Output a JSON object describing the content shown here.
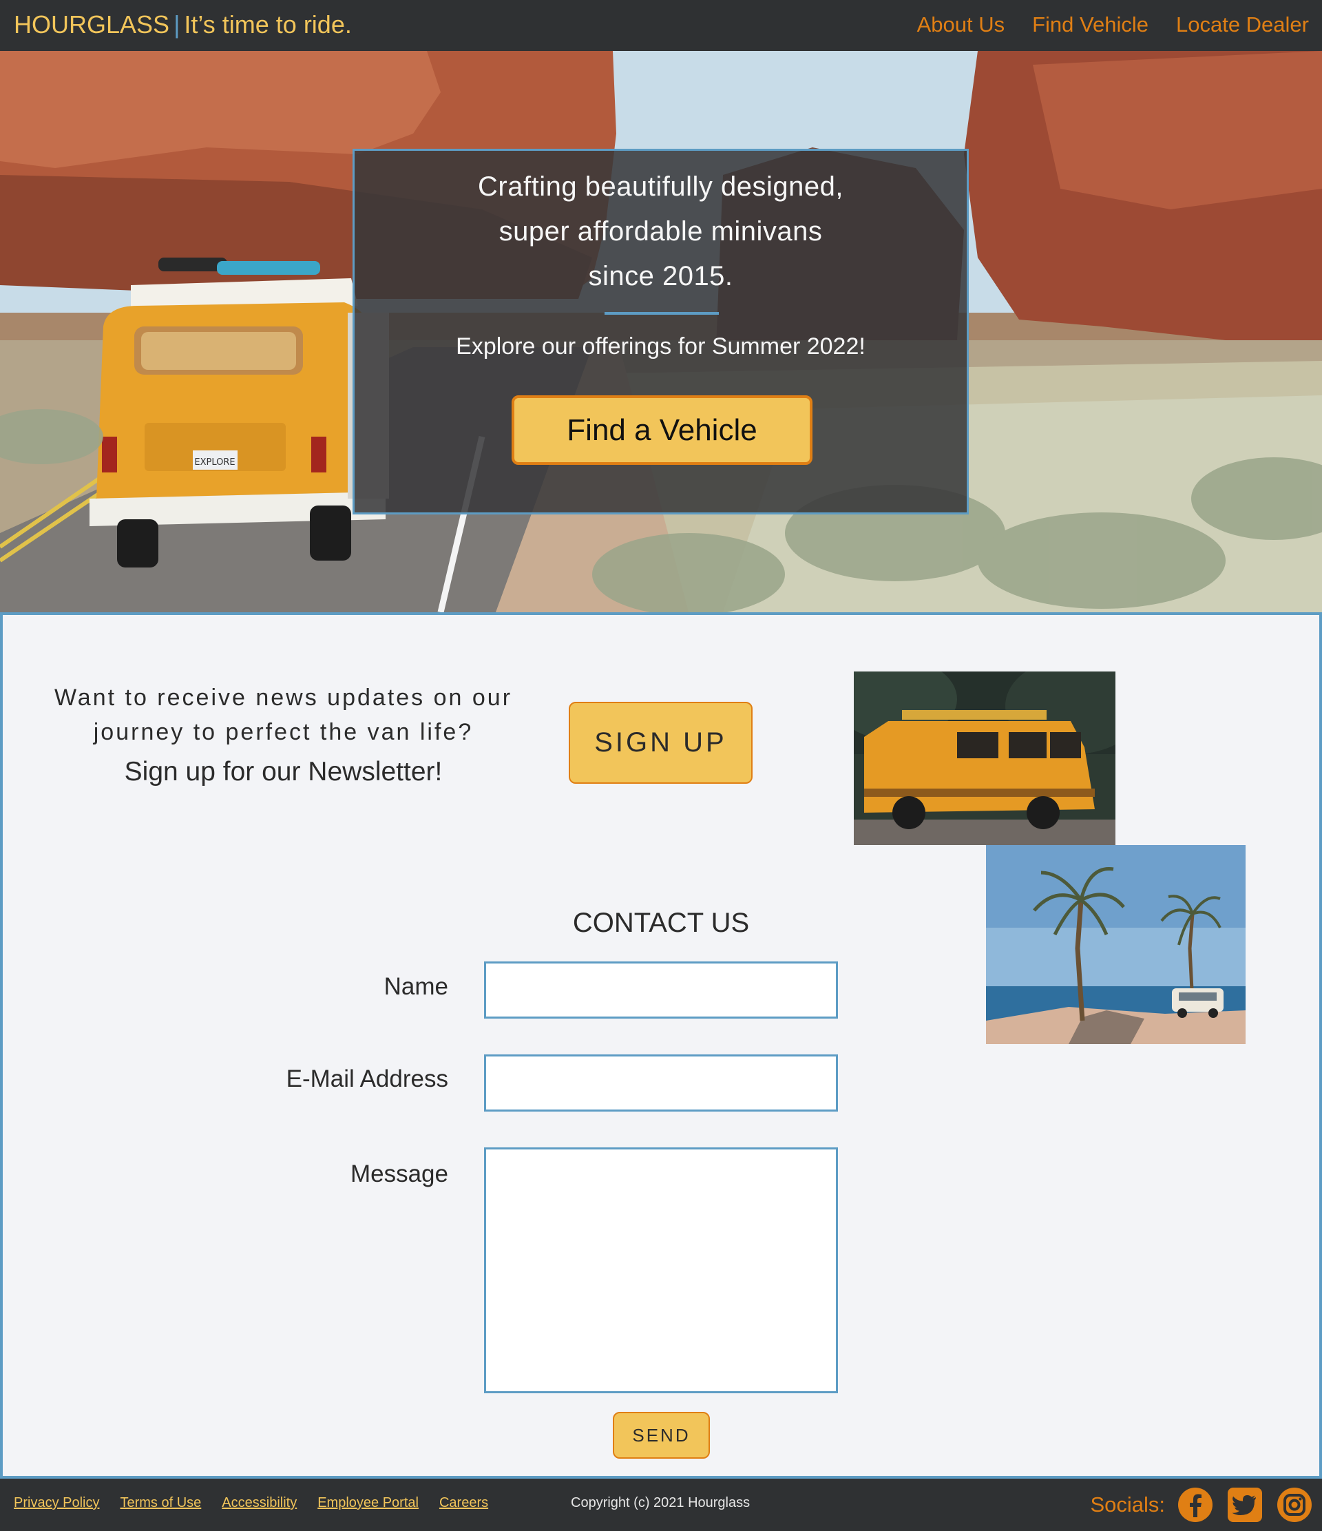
{
  "header": {
    "brand": "HOURGLASS",
    "separator": "|",
    "tagline": "It’s time to ride.",
    "nav": [
      "About Us",
      "Find Vehicle",
      "Locate Dealer"
    ]
  },
  "hero": {
    "title_lines": [
      "Crafting beautifully designed,",
      "super affordable minivans",
      "since 2015."
    ],
    "subtitle": "Explore our offerings for Summer 2022!",
    "cta_label": "Find a Vehicle",
    "van_plate": "EXPLORE"
  },
  "newsletter": {
    "question": "Want to receive news updates on our journey to perfect the van life?",
    "prompt": "Sign up for our Newsletter!",
    "button_label": "SIGN UP"
  },
  "contact": {
    "title": "CONTACT US",
    "fields": {
      "name_label": "Name",
      "email_label": "E-Mail Address",
      "message_label": "Message",
      "name_value": "",
      "email_value": "",
      "message_value": ""
    },
    "send_label": "SEND"
  },
  "footer": {
    "links": [
      "Privacy Policy",
      "Terms of Use",
      "Accessibility",
      "Employee Portal",
      "Careers"
    ],
    "copyright": "Copyright (c) 2021 Hourglass",
    "socials_label": "Socials:",
    "social_icons": [
      "facebook-icon",
      "twitter-icon",
      "instagram-icon"
    ]
  },
  "colors": {
    "brand_yellow": "#f2c55a",
    "accent_orange": "#e07f14",
    "accent_blue": "#5d9cc4",
    "dark": "#2f3133",
    "panel": "#f3f4f7"
  }
}
